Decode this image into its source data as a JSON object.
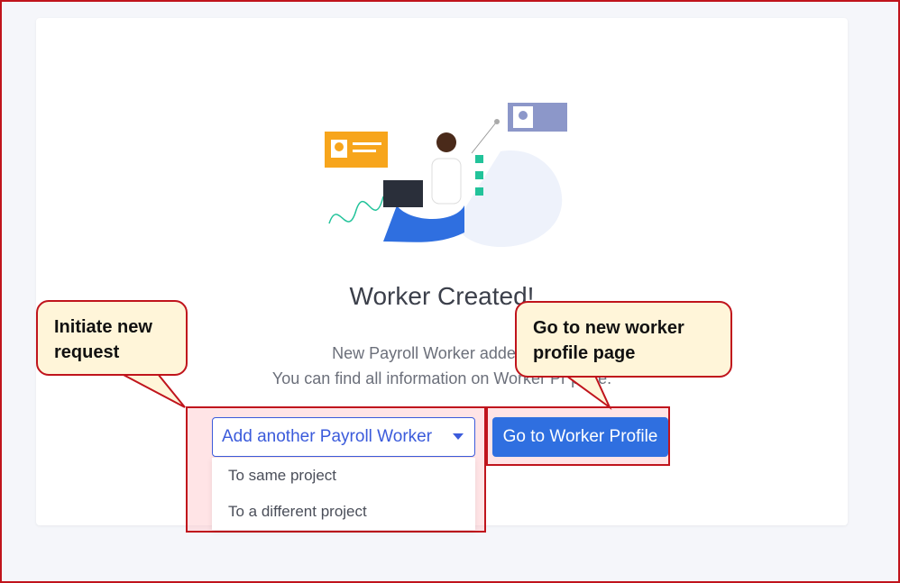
{
  "card": {
    "title": "Worker Created!",
    "message_line1": "New Payroll Worker added to t",
    "message_line2": "You can find all information on Worker Pr       page."
  },
  "actions": {
    "dropdown_label": "Add another Payroll Worker",
    "dropdown_options": [
      "To same project",
      "To a different project"
    ],
    "primary_button": "Go to Worker Profile"
  },
  "callouts": {
    "left": "Initiate new request",
    "right": "Go to new worker profile page"
  },
  "colors": {
    "accent": "#2f6fe0",
    "highlight_border": "#c0141c",
    "callout_bg": "#fff5d9"
  }
}
